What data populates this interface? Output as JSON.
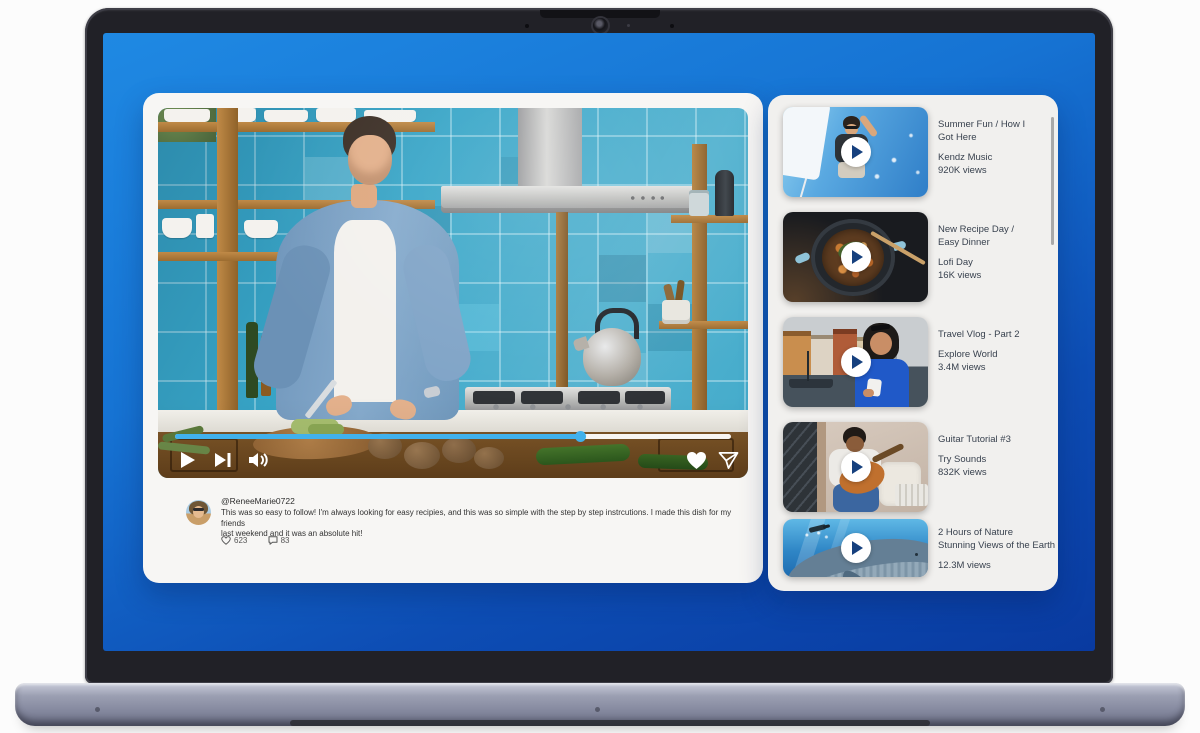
{
  "colors": {
    "desktop_gradient_top": "#1f89e3",
    "desktop_gradient_bottom": "#093aa0",
    "accent_progress_blue": "#41b1ec",
    "play_button_navy": "#16407e",
    "card_background": "#f7f6f4"
  },
  "player": {
    "progress_percent": 73,
    "icons": {
      "play": "play-triangle",
      "next": "next-track",
      "volume": "speaker-waves",
      "like": "heart-filled",
      "share": "paper-plane"
    },
    "comment": {
      "username": "@ReneeMarie0722",
      "text_lines": [
        "This was so easy to follow! I'm always looking for easy recipies, and this was so simple with the step by step instrcutions. I made this dish for my friends",
        "last weekend and it was an absolute hit!"
      ],
      "likes": "623",
      "replies": "83"
    }
  },
  "sidebar": {
    "items": [
      {
        "title_lines": [
          "Summer Fun / How I",
          "Got Here"
        ],
        "channel": "Kendz Music",
        "views": "920K views",
        "thumb": "sailing"
      },
      {
        "title_lines": [
          "New Recipe Day /",
          "Easy Dinner"
        ],
        "channel": "Lofi Day",
        "views": "16K views",
        "thumb": "cooking-pot"
      },
      {
        "title_lines": [
          "Travel Vlog - Part 2"
        ],
        "channel": "Explore World",
        "views": "3.4M views",
        "thumb": "travel-vlog"
      },
      {
        "title_lines": [
          "Guitar Tutorial #3"
        ],
        "channel": "Try Sounds",
        "views": "832K views",
        "thumb": "guitar"
      },
      {
        "title_lines": [
          "2 Hours of Nature",
          "Stunning Views of the Earth"
        ],
        "channel": null,
        "views": "12.3M views",
        "thumb": "whale"
      }
    ]
  }
}
